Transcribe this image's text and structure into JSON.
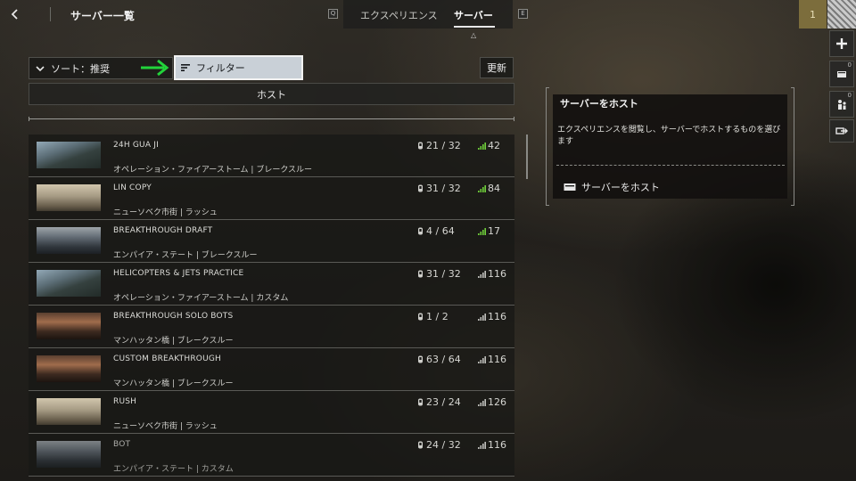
{
  "header": {
    "title": "サーバー一覧",
    "left_key": "Q",
    "right_key": "E",
    "tabs": [
      {
        "label": "エクスペリエンス"
      },
      {
        "label": "サーバー"
      }
    ]
  },
  "rail": {
    "rank": "1",
    "buttons": [
      {
        "count": ""
      },
      {
        "count": "0"
      },
      {
        "count": "0"
      },
      {
        "count": ""
      }
    ]
  },
  "toolbar": {
    "sort_label": "ソート：推奨",
    "filter_label": "フィルター",
    "refresh_label": "更新",
    "host_label": "ホスト"
  },
  "servers": [
    {
      "name": "24H  GUA JI",
      "mode": "オペレーション・ファイアーストーム | ブレークスルー",
      "players": "21 / 32",
      "ping": "42"
    },
    {
      "name": "LIN COPY",
      "mode": "ニューソベク市街 | ラッシュ",
      "players": "31 / 32",
      "ping": "84"
    },
    {
      "name": "BREAKTHROUGH DRAFT",
      "mode": "エンパイア・ステート | ブレークスルー",
      "players": "4 / 64",
      "ping": "17"
    },
    {
      "name": "HELICOPTERS & JETS PRACTICE",
      "mode": "オペレーション・ファイアーストーム | カスタム",
      "players": "31 / 32",
      "ping": "116"
    },
    {
      "name": "BREAKTHROUGH SOLO BOTS",
      "mode": "マンハッタン橋 | ブレークスルー",
      "players": "1 / 2",
      "ping": "116"
    },
    {
      "name": "CUSTOM BREAKTHROUGH",
      "mode": "マンハッタン橋 | ブレークスルー",
      "players": "63 / 64",
      "ping": "116"
    },
    {
      "name": "RUSH",
      "mode": "ニューソベク市街 | ラッシュ",
      "players": "23 / 24",
      "ping": "126"
    },
    {
      "name": "BOT",
      "mode": "エンパイア・ステート | カスタム",
      "players": "24 / 32",
      "ping": "116"
    }
  ],
  "host_panel": {
    "title": "サーバーをホスト",
    "description": "エクスペリエンスを閲覧し、サーバーでホストするものを選びます",
    "action_label": "サーバーをホスト"
  },
  "colors": {
    "annotation_arrow": "#22d33a",
    "ping_signal": "#6fcf3a",
    "filter_bg": "#c9d0d7",
    "rank_bg": "#7c6d3c"
  }
}
